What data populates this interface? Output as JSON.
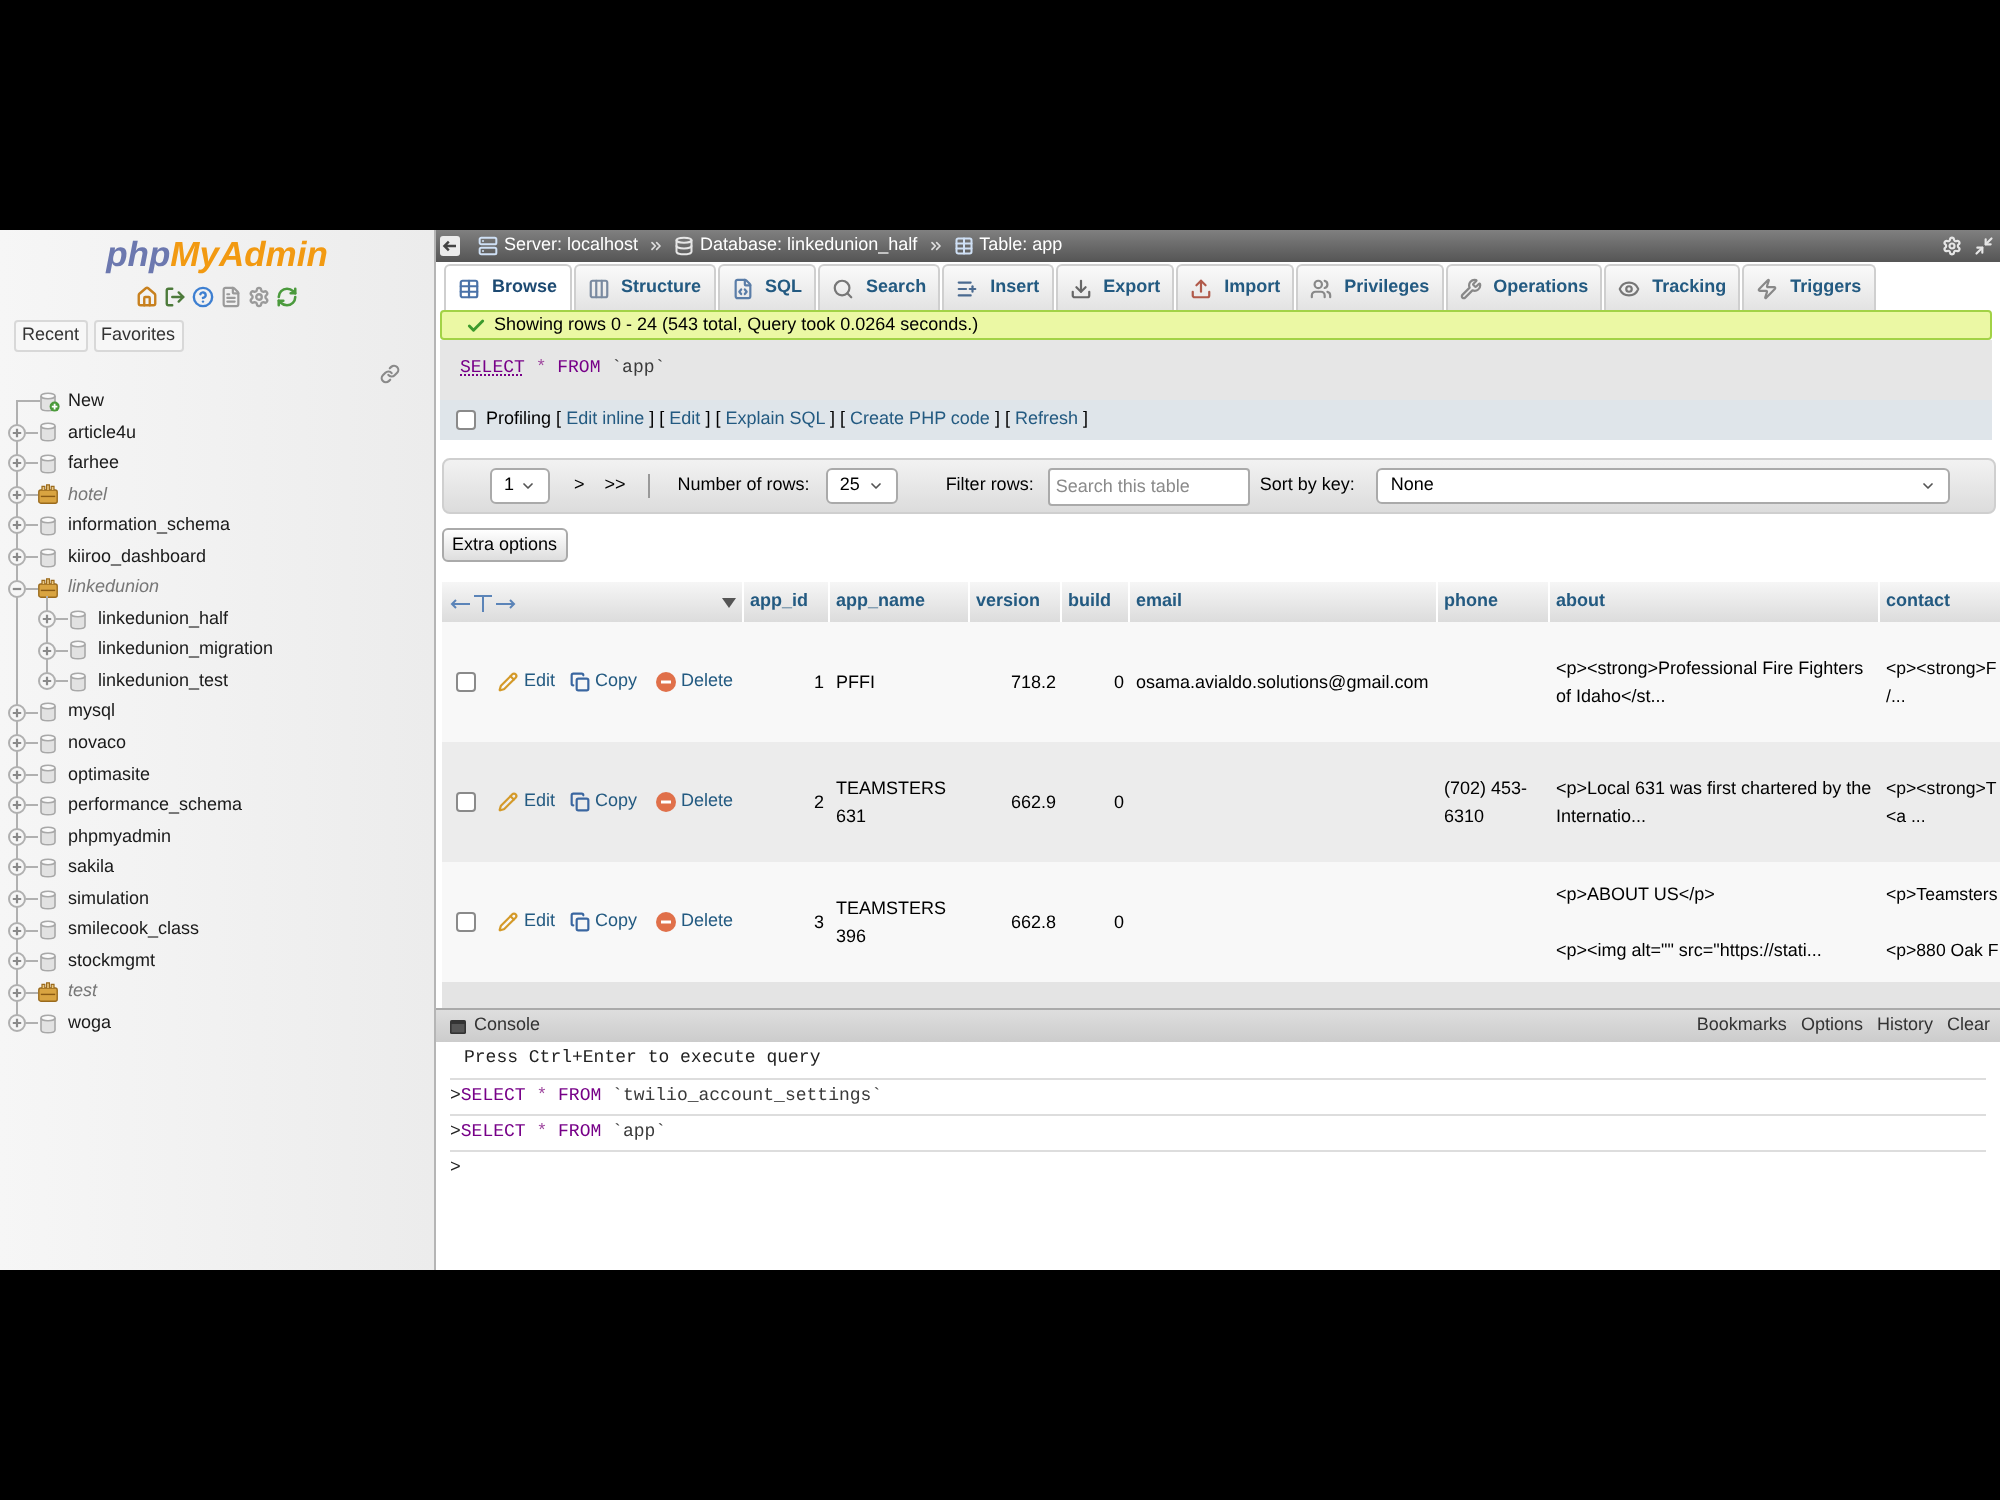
{
  "sidebar": {
    "logo": [
      "php",
      "MyAdmin"
    ],
    "tabs": [
      "Recent",
      "Favorites"
    ],
    "tree": {
      "new_item": "New",
      "items": [
        {
          "name": "article4u",
          "kind": "database",
          "expanded": false
        },
        {
          "name": "farhee",
          "kind": "database",
          "expanded": false
        },
        {
          "name": "hotel",
          "kind": "group",
          "expanded": false
        },
        {
          "name": "information_schema",
          "kind": "database",
          "expanded": false
        },
        {
          "name": "kiiroo_dashboard",
          "kind": "database",
          "expanded": false
        },
        {
          "name": "linkedunion",
          "kind": "group",
          "expanded": true,
          "children": [
            {
              "name": "linkedunion_half",
              "kind": "database",
              "expanded": false
            },
            {
              "name": "linkedunion_migration",
              "kind": "database",
              "expanded": false
            },
            {
              "name": "linkedunion_test",
              "kind": "database",
              "expanded": false
            }
          ]
        },
        {
          "name": "mysql",
          "kind": "database",
          "expanded": false
        },
        {
          "name": "novaco",
          "kind": "database",
          "expanded": false
        },
        {
          "name": "optimasite",
          "kind": "database",
          "expanded": false
        },
        {
          "name": "performance_schema",
          "kind": "database",
          "expanded": false
        },
        {
          "name": "phpmyadmin",
          "kind": "database",
          "expanded": false
        },
        {
          "name": "sakila",
          "kind": "database",
          "expanded": false
        },
        {
          "name": "simulation",
          "kind": "database",
          "expanded": false
        },
        {
          "name": "smilecook_class",
          "kind": "database",
          "expanded": false
        },
        {
          "name": "stockmgmt",
          "kind": "database",
          "expanded": false
        },
        {
          "name": "test",
          "kind": "group",
          "expanded": false
        },
        {
          "name": "woga",
          "kind": "database",
          "expanded": false
        }
      ]
    }
  },
  "breadcrumb": [
    {
      "kind": "server",
      "label": "Server: localhost"
    },
    {
      "kind": "database",
      "label": "Database: linkedunion_half"
    },
    {
      "kind": "table",
      "label": "Table: app"
    }
  ],
  "tabs": [
    {
      "kind": "browse",
      "label": "Browse",
      "selected": true
    },
    {
      "kind": "structure",
      "label": "Structure",
      "selected": false
    },
    {
      "kind": "sql",
      "label": "SQL",
      "selected": false
    },
    {
      "kind": "search",
      "label": "Search",
      "selected": false
    },
    {
      "kind": "insert",
      "label": "Insert",
      "selected": false
    },
    {
      "kind": "export",
      "label": "Export",
      "selected": false
    },
    {
      "kind": "import",
      "label": "Import",
      "selected": false
    },
    {
      "kind": "privileges",
      "label": "Privileges",
      "selected": false
    },
    {
      "kind": "operations",
      "label": "Operations",
      "selected": false
    },
    {
      "kind": "tracking",
      "label": "Tracking",
      "selected": false
    },
    {
      "kind": "triggers",
      "label": "Triggers",
      "selected": false
    }
  ],
  "message": {
    "kind": "success",
    "text": "Showing rows 0 - 24 (543 total, Query took 0.0264 seconds.)"
  },
  "query": [
    {
      "kind": "keyword",
      "text": "SELECT",
      "link": true
    },
    {
      "kind": "operator",
      "text": "*"
    },
    {
      "kind": "keyword",
      "text": "FROM"
    },
    {
      "kind": "identifier",
      "text": "`app`"
    }
  ],
  "profiling": {
    "label": "Profiling",
    "checked": false,
    "links": [
      {
        "open": "[",
        "label": "Edit inline",
        "close": "]"
      },
      {
        "open": "[",
        "label": "Edit",
        "close": "]"
      },
      {
        "open": "[",
        "label": "Explain SQL",
        "close": "]"
      },
      {
        "open": "[",
        "label": "Create PHP code",
        "close": "]"
      },
      {
        "open": "[",
        "label": "Refresh",
        "close": "]"
      }
    ]
  },
  "navigation": {
    "page": "1",
    "next": ">",
    "last": ">>",
    "rows": {
      "label": "Number of rows:",
      "value": "25"
    },
    "filter": {
      "label": "Filter rows:",
      "placeholder": "Search this table"
    },
    "sort": {
      "label": "Sort by key:",
      "value": "None"
    }
  },
  "extra_options": "Extra options",
  "table": {
    "columns": [
      {
        "label": "app_id",
        "kind": "number"
      },
      {
        "label": "app_name",
        "kind": "text"
      },
      {
        "label": "version",
        "kind": "number"
      },
      {
        "label": "build",
        "kind": "number"
      },
      {
        "label": "email",
        "kind": "text"
      },
      {
        "label": "phone",
        "kind": "text"
      },
      {
        "label": "about",
        "kind": "text"
      },
      {
        "label": "contact",
        "kind": "text"
      }
    ],
    "rows": [
      {
        "checked": false,
        "actions": [
          {
            "kind": "edit",
            "label": "Edit"
          },
          {
            "kind": "copy",
            "label": "Copy"
          },
          {
            "kind": "delete",
            "label": "Delete"
          }
        ],
        "cells": [
          "1",
          "PFFI",
          "718.2",
          "0",
          "osama.avialdo.solutions@gmail.com",
          null,
          "<p><strong>Professional Fire Fighters of Idaho</st...",
          "<p><strong>F\n/..."
        ]
      },
      {
        "checked": false,
        "actions": [
          {
            "kind": "edit",
            "label": "Edit"
          },
          {
            "kind": "copy",
            "label": "Copy"
          },
          {
            "kind": "delete",
            "label": "Delete"
          }
        ],
        "cells": [
          "2",
          "TEAMSTERS 631",
          "662.9",
          "0",
          null,
          "(702) 453-6310",
          "<p>Local 631 was first chartered by the Internatio...",
          "<p><strong>T\n<a ..."
        ]
      },
      {
        "checked": false,
        "actions": [
          {
            "kind": "edit",
            "label": "Edit"
          },
          {
            "kind": "copy",
            "label": "Copy"
          },
          {
            "kind": "delete",
            "label": "Delete"
          }
        ],
        "cells": [
          "3",
          "TEAMSTERS 396",
          "662.8",
          "0",
          null,
          null,
          "<p>ABOUT US</p>\n\n<p><img alt=\"\" src=\"https://stati...",
          "<p>Teamsters\n\n<p>880 Oak F"
        ]
      }
    ]
  },
  "console": {
    "title": "Console",
    "options": [
      "Bookmarks",
      "Options",
      "History",
      "Clear"
    ],
    "hint": "Press Ctrl+Enter to execute query",
    "history": [
      {
        "prompt": ">",
        "tokens": [
          {
            "kind": "keyword",
            "text": "SELECT"
          },
          {
            "kind": "operator",
            "text": "*"
          },
          {
            "kind": "keyword",
            "text": "FROM"
          },
          {
            "kind": "identifier",
            "text": "`twilio_account_settings`"
          }
        ]
      },
      {
        "prompt": ">",
        "tokens": [
          {
            "kind": "keyword",
            "text": "SELECT"
          },
          {
            "kind": "operator",
            "text": "*"
          },
          {
            "kind": "keyword",
            "text": "FROM"
          },
          {
            "kind": "identifier",
            "text": "`app`"
          }
        ]
      }
    ],
    "prompt": ">"
  }
}
